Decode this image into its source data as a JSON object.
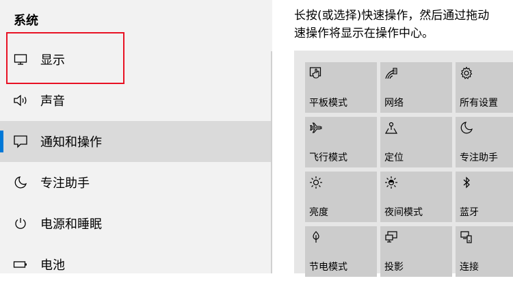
{
  "sidebar": {
    "title": "系统",
    "items": [
      {
        "label": "显示",
        "icon": "monitor-icon"
      },
      {
        "label": "声音",
        "icon": "speaker-icon"
      },
      {
        "label": "通知和操作",
        "icon": "notification-icon"
      },
      {
        "label": "专注助手",
        "icon": "moon-icon"
      },
      {
        "label": "电源和睡眠",
        "icon": "power-icon"
      },
      {
        "label": "电池",
        "icon": "battery-icon"
      }
    ],
    "selected_index": 2
  },
  "main": {
    "description_line1": "长按(或选择)快速操作，然后通过拖动",
    "description_line2": "速操作将显示在操作中心。",
    "tiles": [
      {
        "label": "平板模式",
        "icon": "tablet-mode-icon"
      },
      {
        "label": "网络",
        "icon": "network-icon"
      },
      {
        "label": "所有设置",
        "icon": "gear-icon"
      },
      {
        "label": "飞行模式",
        "icon": "airplane-icon"
      },
      {
        "label": "定位",
        "icon": "location-icon"
      },
      {
        "label": "专注助手",
        "icon": "moon-icon"
      },
      {
        "label": "亮度",
        "icon": "brightness-icon"
      },
      {
        "label": "夜间模式",
        "icon": "night-light-icon"
      },
      {
        "label": "蓝牙",
        "icon": "bluetooth-icon"
      },
      {
        "label": "节电模式",
        "icon": "battery-saver-icon"
      },
      {
        "label": "投影",
        "icon": "project-icon"
      },
      {
        "label": "连接",
        "icon": "connect-icon"
      }
    ]
  },
  "colors": {
    "accent": "#0078d7",
    "highlight_box": "#e81123",
    "sidebar_bg": "#f2f2f2",
    "selected_bg": "#dadada",
    "tile_bg": "#cccccc"
  }
}
